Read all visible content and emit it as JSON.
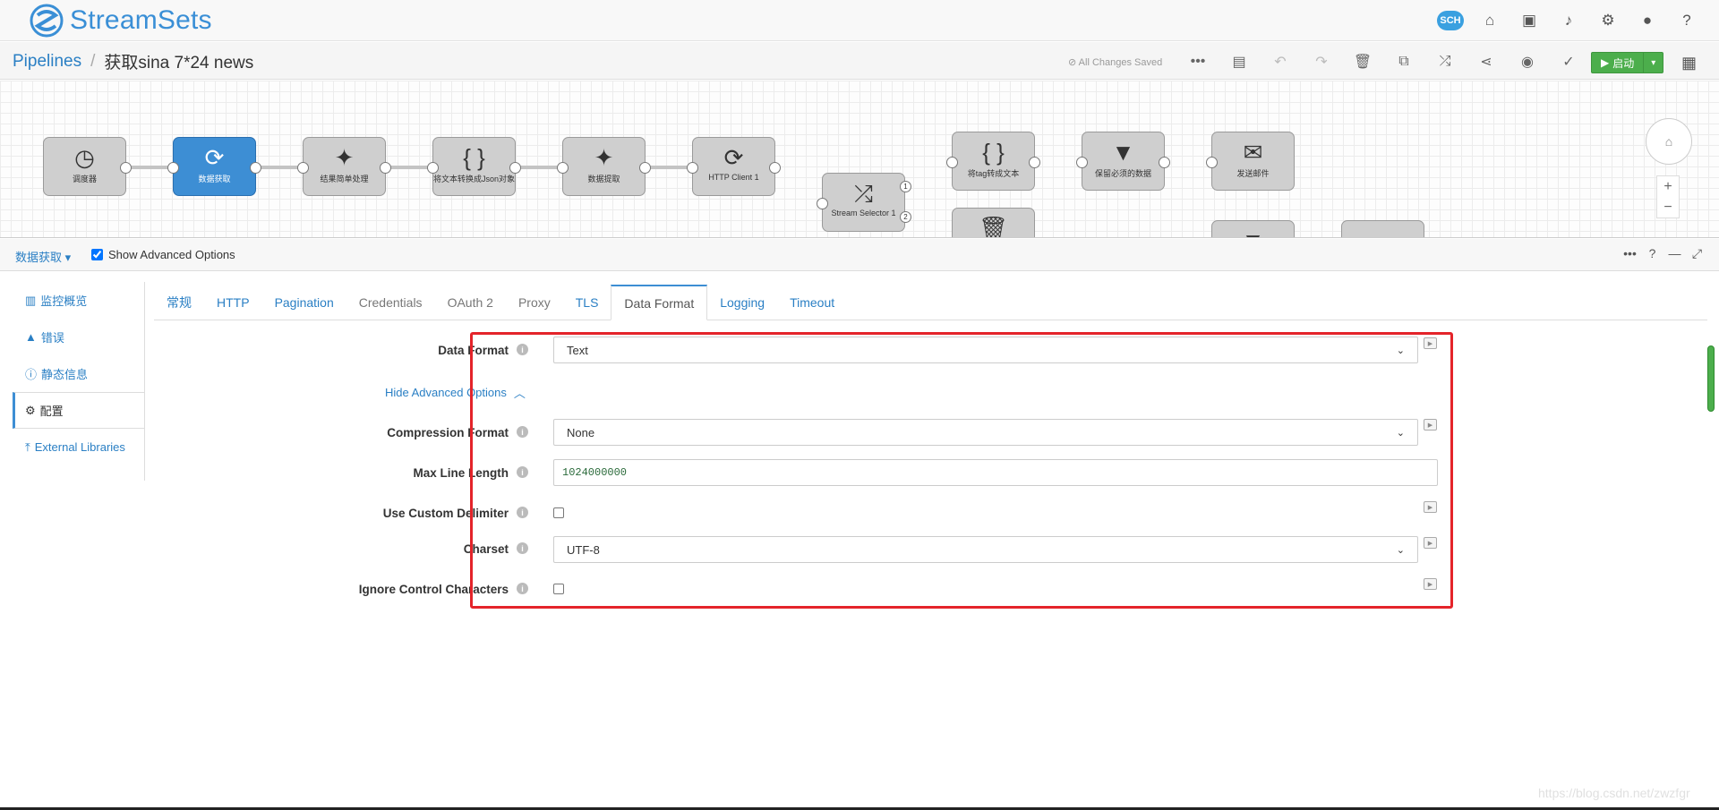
{
  "header": {
    "logo_text": "StreamSets",
    "icons": [
      "sch-badge",
      "home-icon",
      "gift-icon",
      "bell-icon",
      "settings-icon",
      "user-icon",
      "help-icon"
    ],
    "sch_label": "SCH"
  },
  "breadcrumb": {
    "root": "Pipelines",
    "separator": "/",
    "title": "获取sina 7*24 news"
  },
  "toolbar": {
    "saved_status": "All Changes Saved",
    "start_label": "启动"
  },
  "pipeline": {
    "stages": [
      {
        "label": "调度器",
        "icon": "clock-icon"
      },
      {
        "label": "数据获取",
        "icon": "http-client-icon",
        "selected": true
      },
      {
        "label": "结果简单处理",
        "icon": "groovy-icon"
      },
      {
        "label": "将文本转换成Json对象",
        "icon": "json-icon"
      },
      {
        "label": "数据提取",
        "icon": "groovy-icon"
      },
      {
        "label": "HTTP Client 1",
        "icon": "http-client-icon"
      },
      {
        "label": "Stream Selector 1",
        "icon": "shuffle-icon"
      },
      {
        "label": "将tag转成文本",
        "icon": "json-icon"
      },
      {
        "label": "保留必须的数据",
        "icon": "filter-icon"
      },
      {
        "label": "发送邮件",
        "icon": "envelope-icon"
      }
    ],
    "stream_outputs": [
      "1",
      "2"
    ]
  },
  "config_bar": {
    "stage_name": "数据获取",
    "show_advanced_label": "Show Advanced Options",
    "show_advanced_checked": true
  },
  "left_nav": [
    {
      "label": "监控概览",
      "icon": "bar-chart-icon"
    },
    {
      "label": "错误",
      "icon": "warning-icon"
    },
    {
      "label": "静态信息",
      "icon": "info-icon"
    },
    {
      "label": "配置",
      "icon": "gear-icon",
      "active": true
    },
    {
      "label": "External Libraries",
      "icon": "upload-icon"
    }
  ],
  "tabs": [
    {
      "label": "常规"
    },
    {
      "label": "HTTP"
    },
    {
      "label": "Pagination"
    },
    {
      "label": "Credentials",
      "muted": true
    },
    {
      "label": "OAuth 2",
      "muted": true
    },
    {
      "label": "Proxy",
      "muted": true
    },
    {
      "label": "TLS"
    },
    {
      "label": "Data Format",
      "active": true
    },
    {
      "label": "Logging"
    },
    {
      "label": "Timeout"
    }
  ],
  "form": {
    "data_format": {
      "label": "Data Format",
      "value": "Text"
    },
    "hide_advanced_label": "Hide Advanced Options",
    "compression_format": {
      "label": "Compression Format",
      "value": "None"
    },
    "max_line_length": {
      "label": "Max Line Length",
      "value": "1024000000"
    },
    "use_custom_delimiter": {
      "label": "Use Custom Delimiter",
      "checked": false
    },
    "charset": {
      "label": "Charset",
      "value": "UTF-8"
    },
    "ignore_control_chars": {
      "label": "Ignore Control Characters",
      "checked": false
    }
  },
  "watermark": "https://blog.csdn.net/zwzfgr",
  "colors": {
    "accent": "#3d8ed4",
    "start_button": "#4cae4c",
    "highlight_box": "#e4242a"
  }
}
